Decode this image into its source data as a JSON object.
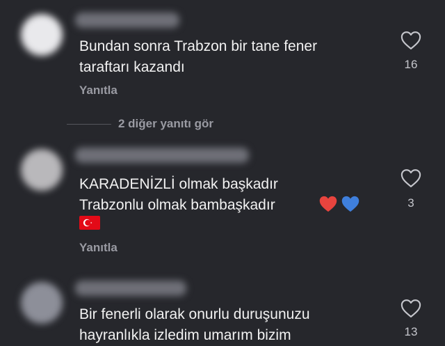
{
  "comments": [
    {
      "text": "Bundan sonra Trabzon bir tane fener\ntaraftarı kazandı",
      "reply_label": "Yanıtla",
      "like_count": "16",
      "more_replies": "2 diğer yanıtı gör"
    },
    {
      "text": "KARADENİZLİ olmak başkadır\nTrabzonlu olmak bambaşkadır",
      "emojis": [
        "red-heart-icon",
        "blue-heart-icon"
      ],
      "flag": "turkey-flag-icon",
      "reply_label": "Yanıtla",
      "like_count": "3"
    },
    {
      "text": "Bir fenerli olarak onurlu duruşunuzu\nhayranlıkla izledim umarım bizim",
      "like_count": "13"
    }
  ],
  "colors": {
    "background": "#26272c",
    "text": "#f2f2f2",
    "muted": "#9a9ba3",
    "heart_red": "#e8443e",
    "heart_blue": "#3f7fdc",
    "flag_red": "#e30a17"
  }
}
